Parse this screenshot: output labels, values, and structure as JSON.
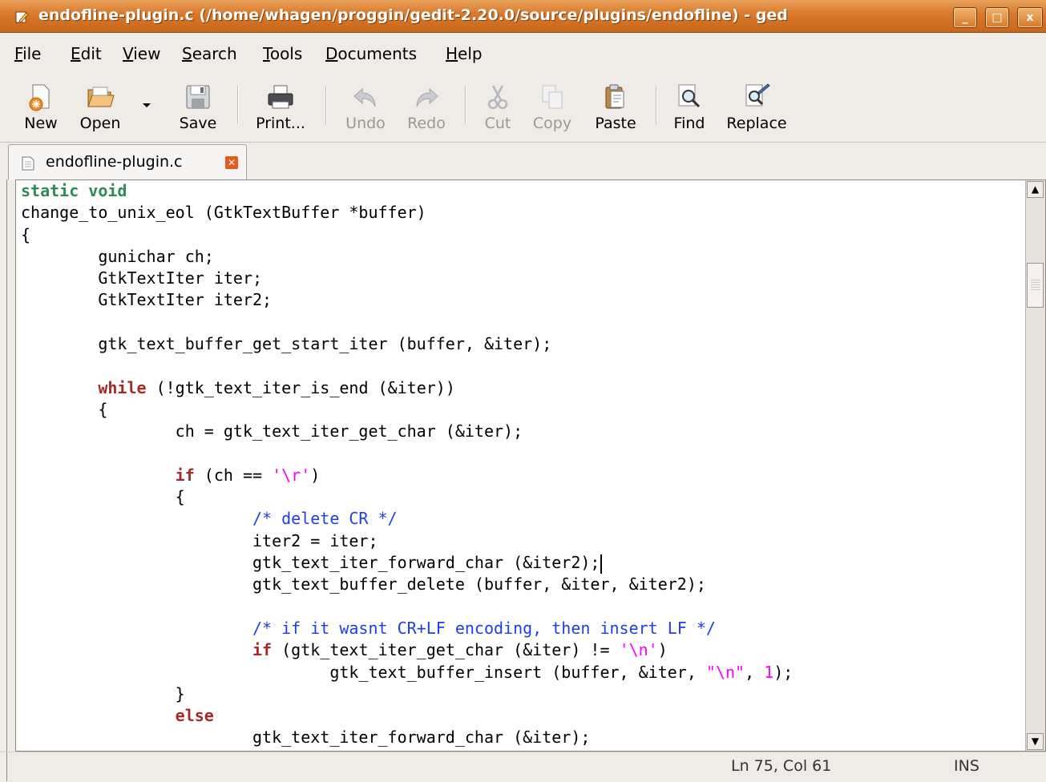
{
  "window": {
    "title": "endofline-plugin.c (/home/whagen/proggin/gedit-2.20.0/source/plugins/endofline) - ged",
    "buttons": {
      "minimize": "_",
      "maximize": "□",
      "close": "x"
    }
  },
  "menu": [
    {
      "accel": "F",
      "rest": "ile"
    },
    {
      "accel": "E",
      "rest": "dit"
    },
    {
      "accel": "V",
      "rest": "iew"
    },
    {
      "accel": "S",
      "rest": "earch"
    },
    {
      "accel": "T",
      "rest": "ools"
    },
    {
      "accel": "D",
      "rest": "ocuments"
    },
    {
      "accel": "H",
      "rest": "elp"
    }
  ],
  "toolbar": {
    "new": "New",
    "open": "Open",
    "save": "Save",
    "print": "Print...",
    "undo": "Undo",
    "redo": "Redo",
    "cut": "Cut",
    "copy": "Copy",
    "paste": "Paste",
    "find": "Find",
    "replace": "Replace"
  },
  "tab": {
    "label": "endofline-plugin.c"
  },
  "code_lines": [
    [
      {
        "t": "static void",
        "c": "ty"
      }
    ],
    [
      {
        "t": "change_to_unix_eol (GtkTextBuffer *buffer)"
      }
    ],
    [
      {
        "t": "{"
      }
    ],
    [
      {
        "t": "        gunichar ch;"
      }
    ],
    [
      {
        "t": "        GtkTextIter iter;"
      }
    ],
    [
      {
        "t": "        GtkTextIter iter2;"
      }
    ],
    [
      {
        "t": ""
      }
    ],
    [
      {
        "t": "        gtk_text_buffer_get_start_iter (buffer, &iter);"
      }
    ],
    [
      {
        "t": ""
      }
    ],
    [
      {
        "t": "        "
      },
      {
        "t": "while",
        "c": "kw"
      },
      {
        "t": " (!gtk_text_iter_is_end (&iter))"
      }
    ],
    [
      {
        "t": "        {"
      }
    ],
    [
      {
        "t": "                ch = gtk_text_iter_get_char (&iter);"
      }
    ],
    [
      {
        "t": ""
      }
    ],
    [
      {
        "t": "                "
      },
      {
        "t": "if",
        "c": "kw"
      },
      {
        "t": " (ch == "
      },
      {
        "t": "'\\r'",
        "c": "st"
      },
      {
        "t": ")"
      }
    ],
    [
      {
        "t": "                {"
      }
    ],
    [
      {
        "t": "                        "
      },
      {
        "t": "/* delete CR */",
        "c": "cm"
      }
    ],
    [
      {
        "t": "                        iter2 = iter;"
      }
    ],
    [
      {
        "t": "                        gtk_text_iter_forward_char (&iter2);"
      },
      {
        "caret": true
      }
    ],
    [
      {
        "t": "                        gtk_text_buffer_delete (buffer, &iter, &iter2);"
      }
    ],
    [
      {
        "t": ""
      }
    ],
    [
      {
        "t": "                        "
      },
      {
        "t": "/* if it wasnt CR+LF encoding, then insert LF */",
        "c": "cm"
      }
    ],
    [
      {
        "t": "                        "
      },
      {
        "t": "if",
        "c": "kw"
      },
      {
        "t": " (gtk_text_iter_get_char (&iter) != "
      },
      {
        "t": "'\\n'",
        "c": "st"
      },
      {
        "t": ")"
      }
    ],
    [
      {
        "t": "                                gtk_text_buffer_insert (buffer, &iter, "
      },
      {
        "t": "\"\\n\"",
        "c": "st"
      },
      {
        "t": ", "
      },
      {
        "t": "1",
        "c": "st"
      },
      {
        "t": ");"
      }
    ],
    [
      {
        "t": "                }"
      }
    ],
    [
      {
        "t": "                "
      },
      {
        "t": "else",
        "c": "kw"
      }
    ],
    [
      {
        "t": "                        gtk_text_iter_forward_char (&iter);"
      }
    ]
  ],
  "status": {
    "position": "Ln 75, Col 61",
    "mode": "INS"
  },
  "icons": {
    "app": "text-editor-icon",
    "new": "new-document-icon",
    "open": "open-folder-icon",
    "save": "save-disk-icon",
    "print": "printer-icon",
    "undo": "undo-arrow-icon",
    "redo": "redo-arrow-icon",
    "cut": "scissors-icon",
    "copy": "copy-icon",
    "paste": "clipboard-icon",
    "find": "magnifier-icon",
    "replace": "find-replace-icon"
  },
  "colors": {
    "titlebar": "#d8782a",
    "keyword": "#a52a2a",
    "type": "#2e8b57",
    "comment": "#1f3ee8",
    "string": "#ff00ff"
  }
}
